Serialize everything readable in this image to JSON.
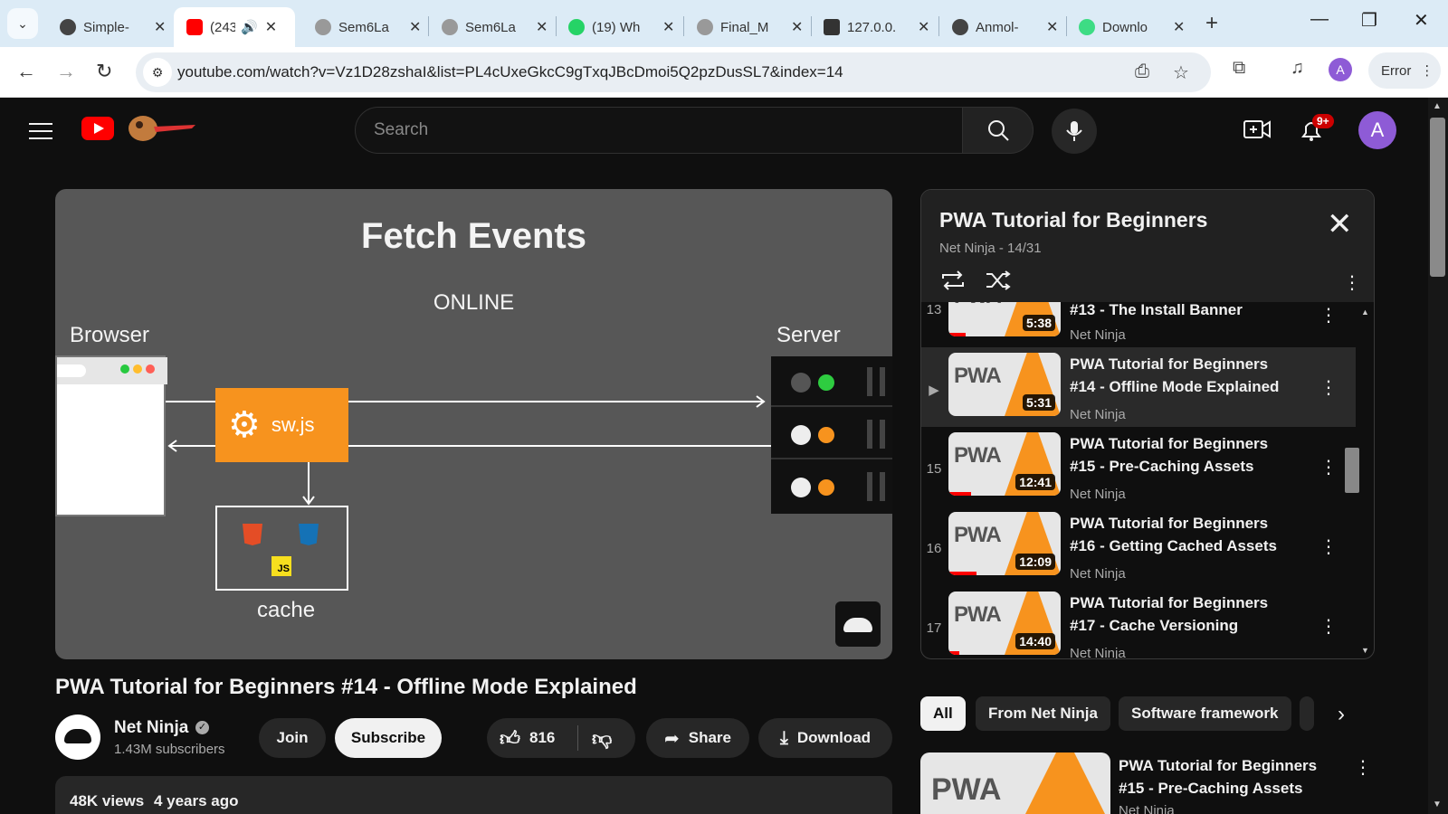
{
  "browser": {
    "tabs": [
      {
        "title": "Simple-",
        "favicon": "github-icon",
        "active": false
      },
      {
        "title": "(243",
        "favicon": "youtube-icon",
        "active": true
      },
      {
        "title": "Sem6La",
        "favicon": "globe-icon",
        "active": false
      },
      {
        "title": "Sem6La",
        "favicon": "globe-icon",
        "active": false
      },
      {
        "title": "(19) Wh",
        "favicon": "whatsapp-icon",
        "active": false
      },
      {
        "title": "Final_M",
        "favicon": "globe-icon",
        "active": false
      },
      {
        "title": "127.0.0.",
        "favicon": "font-icon",
        "active": false
      },
      {
        "title": "Anmol-",
        "favicon": "github-icon",
        "active": false
      },
      {
        "title": "Downlo",
        "favicon": "android-icon",
        "active": false
      }
    ],
    "url": "youtube.com/watch?v=Vz1D28zshaI&list=PL4cUxeGkcC9gTxqJBcDmoi5Q2pzDusSL7&index=14",
    "profile_initial": "A",
    "error_label": "Error"
  },
  "youtube": {
    "search_placeholder": "Search",
    "notif_count": "9+",
    "avatar_initial": "A"
  },
  "video": {
    "slide_title": "Fetch Events",
    "slide_online": "ONLINE",
    "slide_browser": "Browser",
    "slide_server": "Server",
    "slide_sw": "sw.js",
    "slide_cache": "cache",
    "title": "PWA Tutorial for Beginners #14 - Offline Mode Explained",
    "channel": "Net Ninja",
    "subscribers": "1.43M subscribers",
    "join": "Join",
    "subscribe": "Subscribe",
    "likes": "816",
    "share": "Share",
    "download": "Download",
    "views": "48K views",
    "age": "4 years ago"
  },
  "playlist": {
    "title": "PWA Tutorial for Beginners",
    "subtitle": "Net Ninja - 14/31",
    "items": [
      {
        "index": "13",
        "title": "#13 - The Install Banner",
        "channel": "Net Ninja",
        "duration": "5:38",
        "watched": 0.15
      },
      {
        "index": "",
        "title": "PWA Tutorial for Beginners #14 - Offline Mode Explained",
        "channel": "Net Ninja",
        "duration": "5:31",
        "watched": 0.0
      },
      {
        "index": "15",
        "title": "PWA Tutorial for Beginners #15 - Pre-Caching Assets",
        "channel": "Net Ninja",
        "duration": "12:41",
        "watched": 0.2
      },
      {
        "index": "16",
        "title": "PWA Tutorial for Beginners #16 - Getting Cached Assets",
        "channel": "Net Ninja",
        "duration": "12:09",
        "watched": 0.25
      },
      {
        "index": "17",
        "title": "PWA Tutorial for Beginners #17 - Cache Versioning",
        "channel": "Net Ninja",
        "duration": "14:40",
        "watched": 0.1
      }
    ]
  },
  "chips": [
    "All",
    "From Net Ninja",
    "Software framework"
  ],
  "related": {
    "title": "PWA Tutorial for Beginners #15 - Pre-Caching Assets",
    "channel": "Net Ninja"
  },
  "colors": {
    "yt_red": "#ff0000",
    "slide_orange": "#f7931e",
    "dark_bg": "#0f0f0f"
  }
}
